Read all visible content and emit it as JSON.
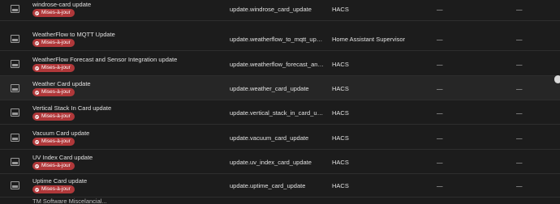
{
  "rows": [
    {
      "name": "windrose-card update",
      "label": "Mises-à-jour",
      "entity_id": "update.windrose_card_update",
      "integration": "HACS",
      "area": "—",
      "status": "—"
    },
    {
      "name": "WeatherFlow to MQTT Update",
      "label": "Mises-à-jour",
      "entity_id": "update.weatherflow_to_mqtt_update",
      "integration": "Home Assistant Supervisor",
      "area": "—",
      "status": "—"
    },
    {
      "name": "WeatherFlow Forecast and Sensor Integration update",
      "label": "Mises-à-jour",
      "entity_id": "update.weatherflow_forecast_and_se...",
      "integration": "HACS",
      "area": "—",
      "status": "—"
    },
    {
      "name": "Weather Card update",
      "label": "Mises-à-jour",
      "entity_id": "update.weather_card_update",
      "integration": "HACS",
      "area": "—",
      "status": "—"
    },
    {
      "name": "Vertical Stack In Card update",
      "label": "Mises-à-jour",
      "entity_id": "update.vertical_stack_in_card_update",
      "integration": "HACS",
      "area": "—",
      "status": "—"
    },
    {
      "name": "Vacuum Card update",
      "label": "Mises-à-jour",
      "entity_id": "update.vacuum_card_update",
      "integration": "HACS",
      "area": "—",
      "status": "—"
    },
    {
      "name": "UV Index Card update",
      "label": "Mises-à-jour",
      "entity_id": "update.uv_index_card_update",
      "integration": "HACS",
      "area": "—",
      "status": "—"
    },
    {
      "name": "Uptime Card update",
      "label": "Mises-à-jour",
      "entity_id": "update.uptime_card_update",
      "integration": "HACS",
      "area": "—",
      "status": "—"
    }
  ],
  "partial_row_text": "TM Software Miscelancial..."
}
